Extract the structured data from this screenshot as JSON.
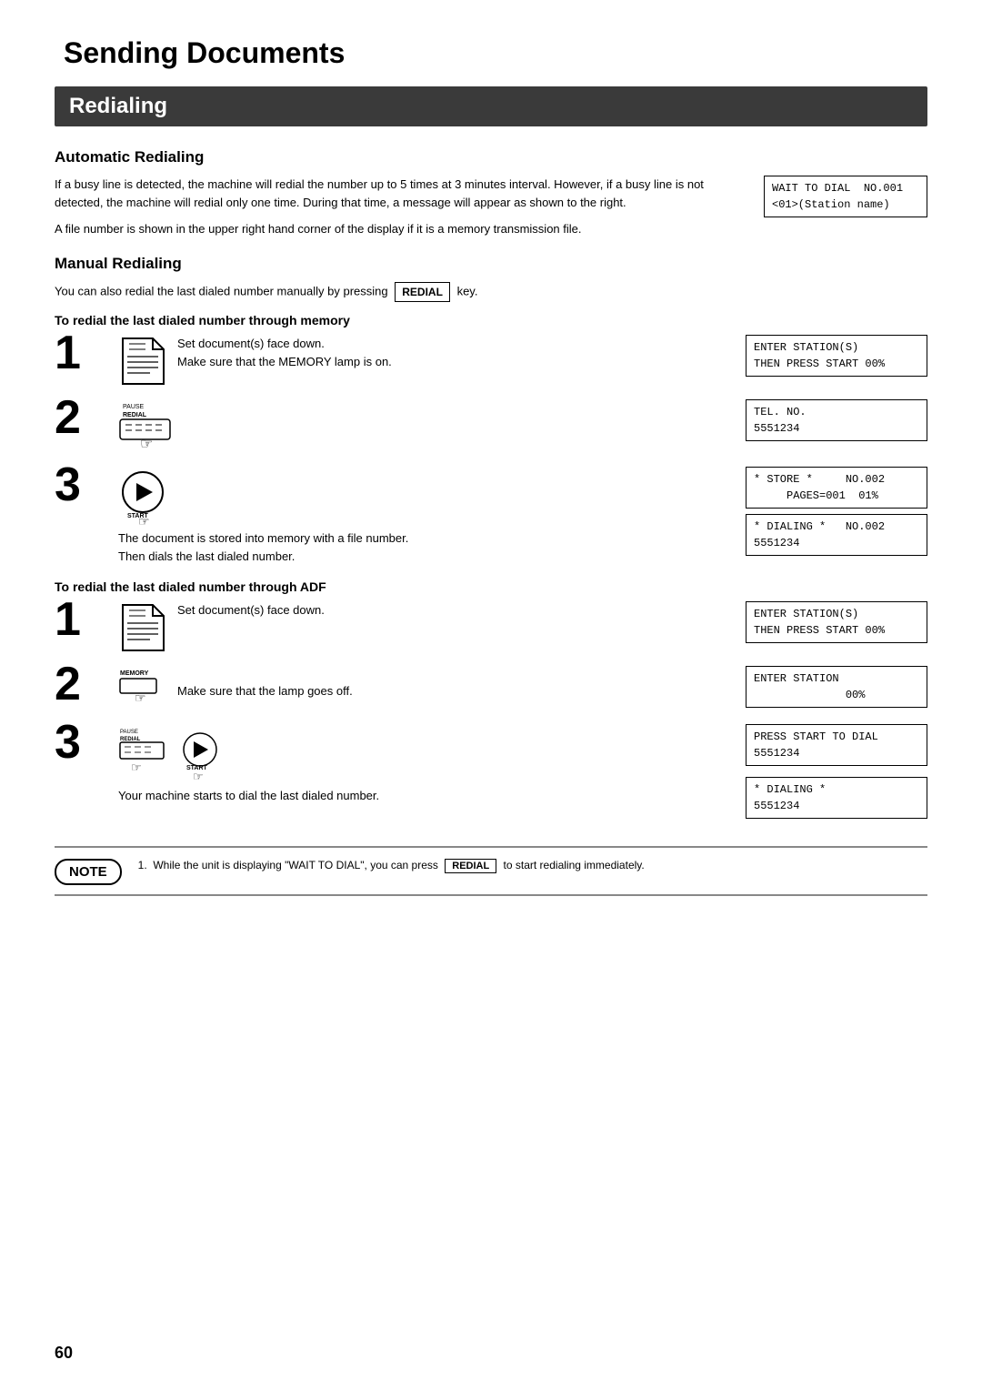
{
  "page": {
    "main_title": "Sending Documents",
    "section_header": "Redialing",
    "page_number": "60"
  },
  "automatic_redialing": {
    "title": "Automatic Redialing",
    "body1": "If a busy line is detected, the machine will redial the number up to 5 times at 3 minutes interval.  However, if a busy line is not detected, the machine will redial only one time.  During that time, a message will appear as shown to the right.",
    "body2": "A file number is shown in the upper right hand corner of the display if it is a memory transmission file.",
    "display": "WAIT TO DIAL  NO.001\n<01>(Station name)"
  },
  "manual_redialing": {
    "title": "Manual Redialing",
    "intro": "You can also redial the last dialed number manually by pressing",
    "key_label": "REDIAL",
    "intro_end": "key.",
    "memory_section": {
      "label": "To redial the last dialed number through memory",
      "steps": [
        {
          "number": "1",
          "icon_type": "doc",
          "text": "Set document(s) face down.\nMake sure that the MEMORY lamp is on.",
          "displays": [
            "ENTER STATION(S)\nTHEN PRESS START 00%"
          ]
        },
        {
          "number": "2",
          "icon_type": "keyboard",
          "text": "",
          "displays": [
            "TEL. NO.\n5551234"
          ]
        },
        {
          "number": "3",
          "icon_type": "start",
          "text": "The document is stored into memory with a file number.\nThen dials the last dialed number.",
          "displays": [
            "* STORE *     NO.002\n     PAGES=001  01%",
            "* DIALING *   NO.002\n5551234"
          ]
        }
      ]
    },
    "adf_section": {
      "label": "To redial the last dialed number through ADF",
      "steps": [
        {
          "number": "1",
          "icon_type": "doc",
          "text": "Set document(s) face down.",
          "displays": [
            "ENTER STATION(S)\nTHEN PRESS START 00%"
          ]
        },
        {
          "number": "2",
          "icon_type": "memory",
          "text": "Make sure that the lamp goes off.",
          "displays": [
            "ENTER STATION\n              00%"
          ]
        },
        {
          "number": "3",
          "icon_type": "keyboard_start",
          "text": "Your machine starts to dial the last dialed number.",
          "displays": [
            "PRESS START TO DIAL\n5551234",
            "* DIALING *\n5551234"
          ]
        }
      ]
    }
  },
  "note": {
    "label": "NOTE",
    "items": [
      {
        "number": "1",
        "text": "While the unit is displaying \"WAIT TO DIAL\", you can press",
        "key": "REDIAL",
        "text_end": "to start redialing immediately."
      }
    ]
  }
}
